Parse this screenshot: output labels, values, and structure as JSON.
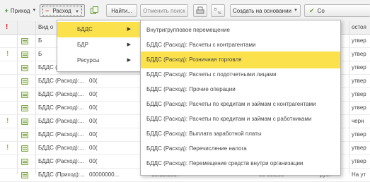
{
  "toolbar": {
    "prihod": "Приход",
    "rashod": "Расход",
    "find": "Найти...",
    "cancel_search": "Отменить поиск",
    "create_based": "Создать на основании",
    "clipped": "Со"
  },
  "grid": {
    "header_type": "Вид о",
    "header_status": "остоя",
    "rows": [
      {
        "mark": "",
        "type": "Б",
        "num": "",
        "date": "",
        "sum": "",
        "cur": "",
        "status": "утвер"
      },
      {
        "mark": "!",
        "type": "Б",
        "num": "",
        "date": "",
        "sum": "",
        "cur": "",
        "status": "утвер"
      },
      {
        "mark": "",
        "type": "БДДС (Расход):...",
        "num": "00(",
        "date": "",
        "sum": "",
        "cur": "",
        "status": "утвер"
      },
      {
        "mark": "",
        "type": "БДДС (Расход):...",
        "num": "00(",
        "date": "",
        "sum": "",
        "cur": "",
        "status": "утвер"
      },
      {
        "mark": "",
        "type": "БДДС (Расход):...",
        "num": "00(",
        "date": "",
        "sum": "",
        "cur": "",
        "status": "утвер"
      },
      {
        "mark": "",
        "type": "БДДС (Расход):...",
        "num": "00(",
        "date": "",
        "sum": "",
        "cur": "",
        "status": "утвер"
      },
      {
        "mark": "!",
        "type": "БДДС (Расход):...",
        "num": "00(",
        "date": "",
        "sum": "",
        "cur": "",
        "status": "черн"
      },
      {
        "mark": "",
        "type": "БДДС (Расход):...",
        "num": "00(",
        "date": "",
        "sum": "",
        "cur": "",
        "status": "утвер"
      },
      {
        "mark": "!",
        "type": "БДДС (Расход):...",
        "num": "00(",
        "date": "",
        "sum": "",
        "cur": "",
        "status": "утвер"
      },
      {
        "mark": "",
        "type": "БДДС (Расход):...",
        "num": "00(",
        "date": "",
        "sum": "",
        "cur": "",
        "status": "утвер"
      },
      {
        "mark": "",
        "type": "БДДС (Приход):...",
        "num": "00000000...",
        "date": "18.12.2017",
        "sum": "88 888,00",
        "cur": "руб.",
        "status": "На ут"
      }
    ]
  },
  "submenu1": {
    "items": [
      {
        "label": "БДДС",
        "arrow": "▶",
        "selected": true
      },
      {
        "label": "БДР",
        "arrow": "▶",
        "selected": false
      },
      {
        "label": "Ресурсы",
        "arrow": "▶",
        "selected": false
      }
    ]
  },
  "submenu2": {
    "items": [
      {
        "label": "Внутригрупповое перемещение",
        "selected": false
      },
      {
        "label": "БДДС (Расход): Расчеты с контрагентами",
        "selected": false
      },
      {
        "label": "БДДС (Расход): Розничная торговля",
        "selected": true
      },
      {
        "label": "БДДС (Расход): Расчеты с подотчетными лицами",
        "selected": false
      },
      {
        "label": "БДДС (Расход): Прочие операции",
        "selected": false
      },
      {
        "label": "БДДС (Расход): Расчеты по кредитам и займам с контрагентами",
        "selected": false
      },
      {
        "label": "БДДС (Расход): Расчеты по кредитам и займам с работниками",
        "selected": false
      },
      {
        "label": "БДДС (Расход): Выплата заработной платы",
        "selected": false
      },
      {
        "label": "БДДС (Расход): Перечисление налога",
        "selected": false
      },
      {
        "label": "БДДС (Расход): Перемещение средств внутри организации",
        "selected": false
      }
    ]
  },
  "colors": {
    "highlight": "#fbe24c",
    "warning_mark": "#d4a10b",
    "add_green": "#2e8b2e",
    "remove_red": "#cc2222"
  }
}
